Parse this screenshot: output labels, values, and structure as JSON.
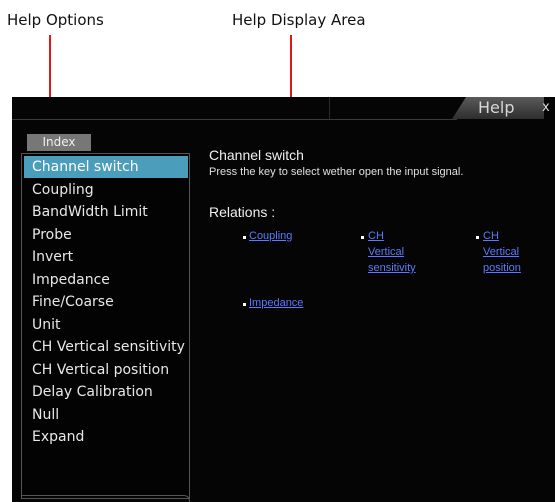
{
  "callouts": {
    "help_options": "Help Options",
    "help_display_area": "Help Display Area"
  },
  "colors": {
    "arrow": "#e01818",
    "selected_item_bg": "#4a9ebc",
    "link": "#5e78ff",
    "screen_bg": "#050505"
  },
  "header": {
    "help_tab": "Help",
    "close_label": "x"
  },
  "index": {
    "tab_label": "Index",
    "items": [
      {
        "label": "Channel switch",
        "selected": true
      },
      {
        "label": "Coupling"
      },
      {
        "label": "BandWidth Limit"
      },
      {
        "label": "Probe"
      },
      {
        "label": "Invert"
      },
      {
        "label": "Impedance"
      },
      {
        "label": "Fine/Coarse"
      },
      {
        "label": "Unit"
      },
      {
        "label": "CH Vertical sensitivity"
      },
      {
        "label": "CH Vertical position"
      },
      {
        "label": "Delay Calibration"
      },
      {
        "label": "Null"
      },
      {
        "label": "Expand"
      }
    ]
  },
  "display": {
    "title": "Channel switch",
    "description": "Press the key to select wether open the input signal.",
    "relations_label": "Relations :",
    "links": {
      "coupling": "Coupling",
      "ch_vert_sens_line1": "CH",
      "ch_vert_sens_line2": "Vertical",
      "ch_vert_sens_line3": "sensitivity",
      "ch_vert_pos_line1": "CH",
      "ch_vert_pos_line2": "Vertical",
      "ch_vert_pos_line3": "position",
      "impedance": "Impedance"
    }
  }
}
